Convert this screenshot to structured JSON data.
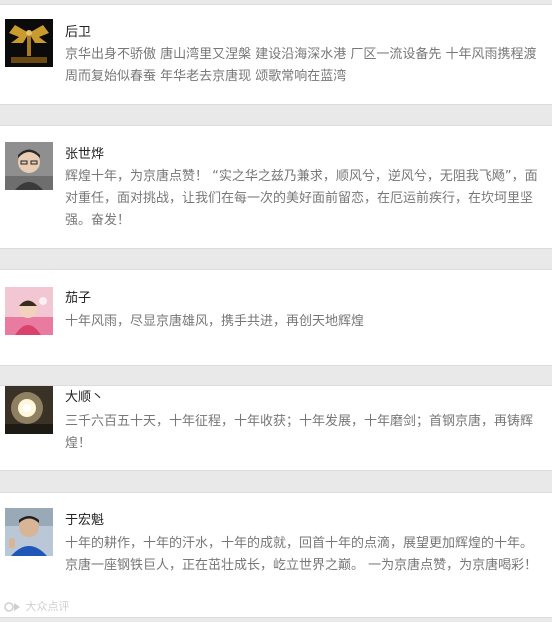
{
  "comments": [
    {
      "name": "后卫",
      "avatar": "avatar-dark-winged-figure",
      "text": "京华出身不骄傲 唐山湾里又涅槃 建设沿海深水港 厂区一流设备先 十年风雨携程渡 周而复始似春蚕 年华老去京唐现 颂歌常响在蓝湾"
    },
    {
      "name": "张世烨",
      "avatar": "avatar-man-glasses",
      "text": "辉煌十年，为京唐点赞！ “实之华之兹乃兼求，顺风兮，逆风兮，无阻我飞飏”，面对重任，面对挑战，让我们在每一次的美好面前留恋，在厄运前疾行，在坎坷里坚强。奋发！"
    },
    {
      "name": "茄子",
      "avatar": "avatar-child-pink",
      "text": "十年风雨，尽显京唐雄风，携手共进，再创天地辉煌"
    },
    {
      "name": "大顺丶",
      "avatar": "avatar-light-glow",
      "text": "三千六百五十天，十年征程，十年收获；十年发展，十年磨剑；首钢京唐，再铸辉煌！"
    },
    {
      "name": "于宏魁",
      "avatar": "avatar-man-blue-shirt",
      "text": "十年的耕作，十年的汗水，十年的成就，回首十年的点滴，展望更加辉煌的十年。京唐一座钢铁巨人，正在茁壮成长，屹立世界之巅。 一为京唐点赞，为京唐喝彩！"
    }
  ],
  "watermark": {
    "icon": "watermark-logo-icon",
    "text": "大众点评"
  }
}
